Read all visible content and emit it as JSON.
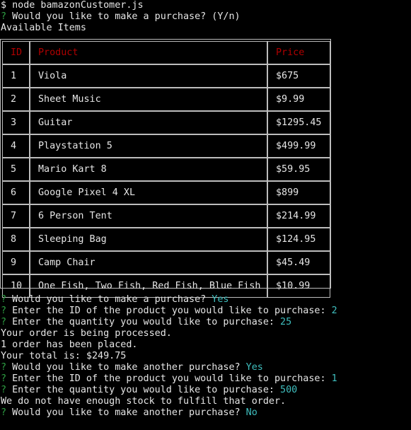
{
  "terminal": {
    "command": "$ node bamazonCustomer.js",
    "prompt_mark": "?",
    "first_prompt": {
      "question": "Would you like to make a purchase?",
      "hint": "(Y/n)"
    },
    "available_label": "Available Items",
    "table": {
      "headers": [
        "ID",
        "Product",
        "Price"
      ],
      "rows": [
        [
          "1",
          "Viola",
          "$675"
        ],
        [
          "2",
          "Sheet Music",
          "$9.99"
        ],
        [
          "3",
          "Guitar",
          "$1295.45"
        ],
        [
          "4",
          "Playstation 5",
          "$499.99"
        ],
        [
          "5",
          "Mario Kart 8",
          "$59.95"
        ],
        [
          "6",
          "Google Pixel 4 XL",
          "$899"
        ],
        [
          "7",
          "6 Person Tent",
          "$214.99"
        ],
        [
          "8",
          "Sleeping Bag",
          "$124.95"
        ],
        [
          "9",
          "Camp Chair",
          "$45.49"
        ],
        [
          "10",
          "One Fish, Two Fish, Red Fish, Blue Fish",
          "$10.99"
        ]
      ]
    },
    "session": [
      {
        "type": "prompt",
        "text": "Would you like to make a purchase?",
        "answer": "Yes"
      },
      {
        "type": "prompt",
        "text": "Enter the ID of the product you would like to purchase:",
        "answer": "2"
      },
      {
        "type": "prompt",
        "text": "Enter the quantity you would like to purchase:",
        "answer": "25"
      },
      {
        "type": "output",
        "text": "Your order is being processed."
      },
      {
        "type": "output",
        "text": "1 order has been placed."
      },
      {
        "type": "output",
        "text": "Your total is: $249.75"
      },
      {
        "type": "prompt",
        "text": "Would you like to make another purchase?",
        "answer": "Yes"
      },
      {
        "type": "prompt",
        "text": "Enter the ID of the product you would like to purchase:",
        "answer": "1"
      },
      {
        "type": "prompt",
        "text": "Enter the quantity you would like to purchase:",
        "answer": "500"
      },
      {
        "type": "output",
        "text": "We do not have enough stock to fulfill that order."
      },
      {
        "type": "prompt",
        "text": "Would you like to make another purchase?",
        "answer": "No"
      }
    ],
    "colors": {
      "background": "#000000",
      "text": "#e6e6e6",
      "prompt_mark": "#2ea043",
      "answer": "#3fbfbf",
      "header": "#b00000",
      "border": "#bdbdbd"
    }
  }
}
